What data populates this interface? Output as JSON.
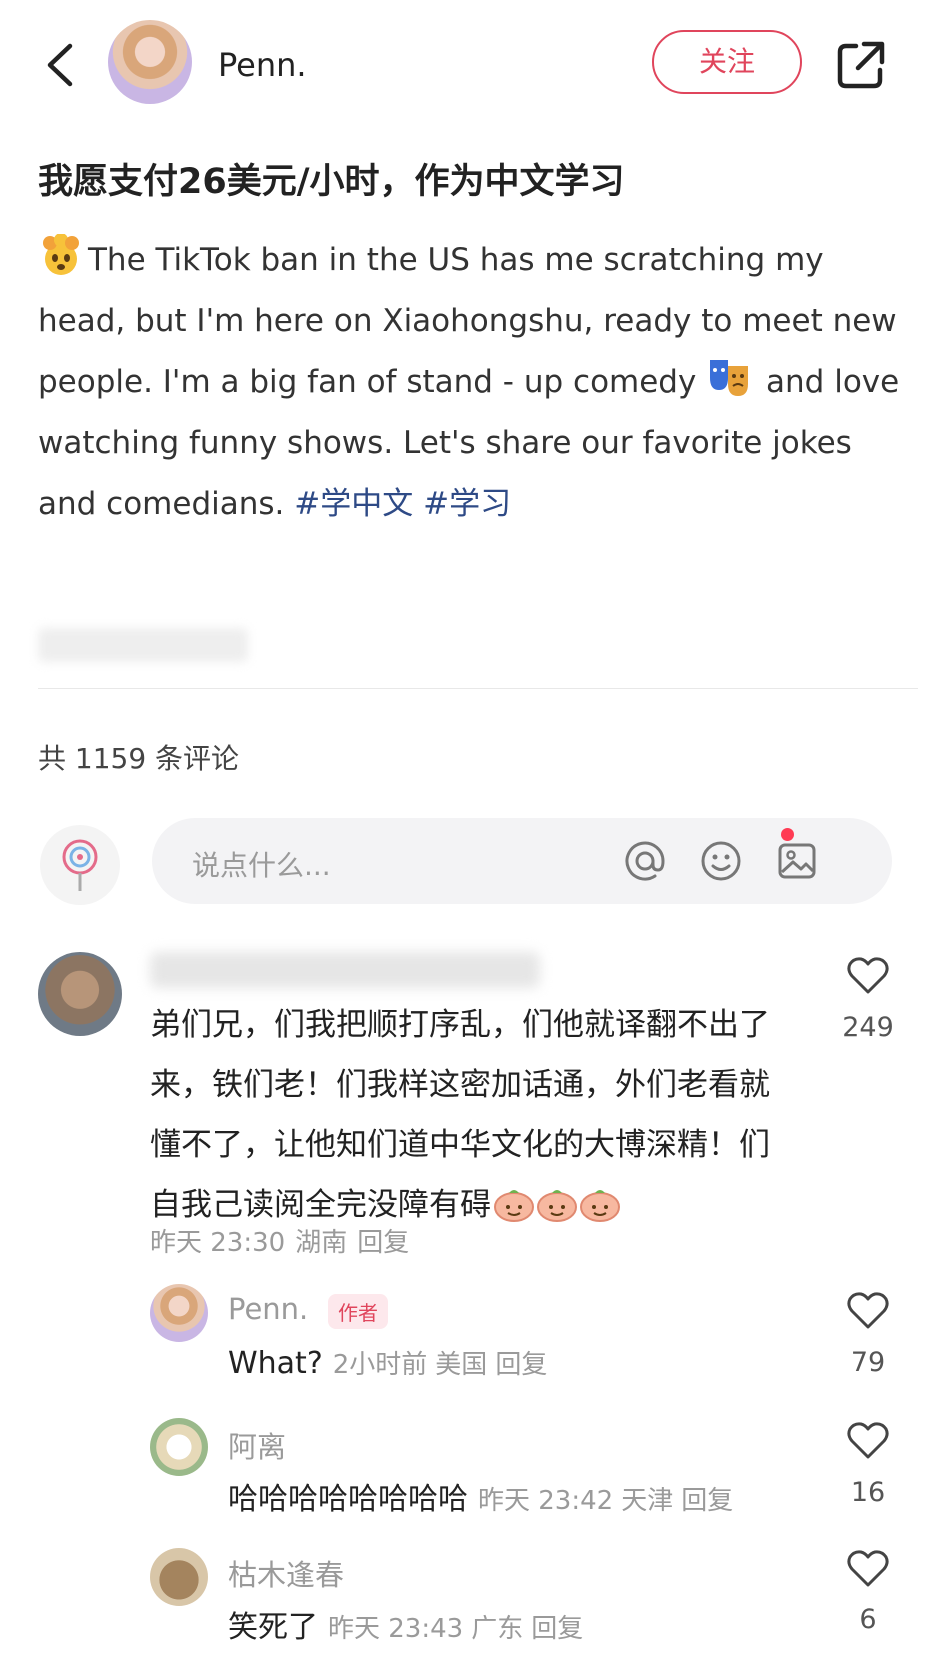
{
  "header": {
    "author_name": "Penn.",
    "follow_label": "关注"
  },
  "post": {
    "title": "我愿支付26美元/小时，作为中文学习",
    "body_part1": "The TikTok ban in the US has me scratching my head, but I'm here on Xiaohongshu, ready to meet new people. I'm a big fan of stand - up comedy ",
    "body_part2": " and love watching funny shows. Let's share our favorite jokes and comedians. ",
    "tags": [
      "#学中文",
      "#学习"
    ]
  },
  "comments_header": {
    "count_text": "共 1159 条评论"
  },
  "comment_input": {
    "placeholder": "说点什么..."
  },
  "comments": [
    {
      "text": "弟们兄，们我把顺打序乱，们他就译翻不出了来，铁们老！们我样这密加话通，外们老看就懂不了，让他知们道中华文化的大博深精！们自我己读阅全完没障有碍",
      "time": "昨天 23:30",
      "location": "湖南",
      "reply_label": "回复",
      "likes": "249"
    }
  ],
  "replies": [
    {
      "name": "Penn.",
      "badge": "作者",
      "text": "What?",
      "time": "2小时前",
      "location": "美国",
      "reply_label": "回复",
      "likes": "79"
    },
    {
      "name": "阿离",
      "text": "哈哈哈哈哈哈哈哈",
      "time": "昨天 23:42",
      "location": "天津",
      "reply_label": "回复",
      "likes": "16"
    },
    {
      "name": "枯木逢春",
      "text": "笑死了",
      "time": "昨天 23:43",
      "location": "广东",
      "reply_label": "回复",
      "likes": "6"
    }
  ],
  "colors": {
    "accent": "#e0455c",
    "tag": "#2e4a86"
  }
}
